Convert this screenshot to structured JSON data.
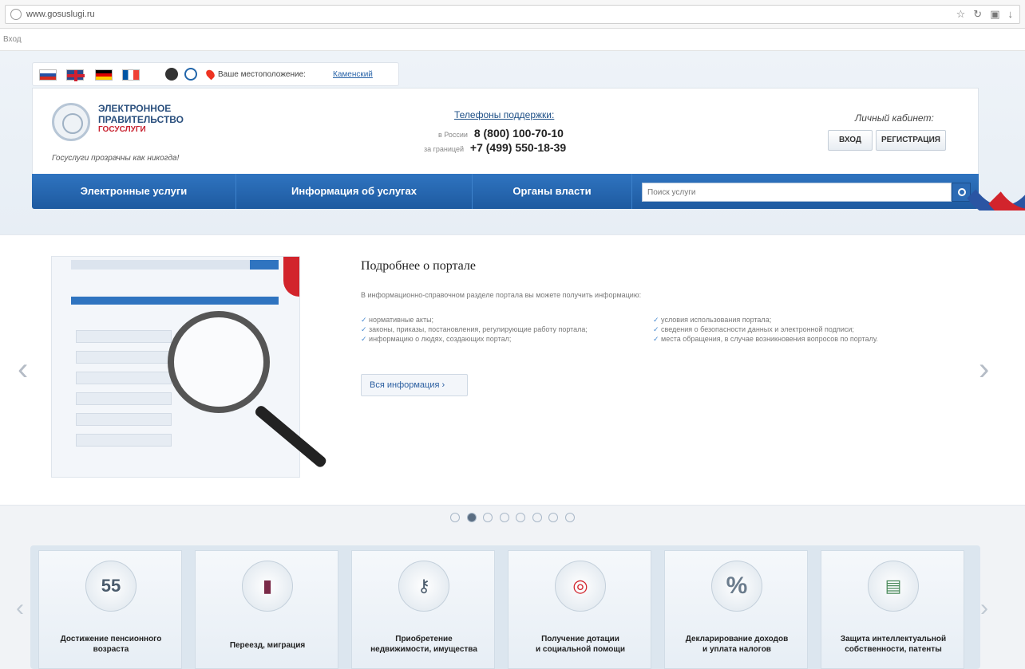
{
  "browser": {
    "url": "www.gosuslugi.ru",
    "find_text": "Вход"
  },
  "header": {
    "location_label": "Ваше местоположение:",
    "location_value": "Каменский",
    "logo": {
      "line1": "ЭЛЕКТРОННОЕ",
      "line2": "ПРАВИТЕЛЬСТВО",
      "line3": "ГОСУСЛУГИ"
    },
    "tagline": "Госуслуги прозрачны как никогда!",
    "support": {
      "title": "Телефоны поддержки:",
      "russia_label": "в России",
      "russia_phone": "8 (800) 100-70-10",
      "abroad_label": "за границей",
      "abroad_phone": "+7 (499) 550-18-39"
    },
    "cabinet": {
      "title": "Личный кабинет:",
      "login": "ВХОД",
      "register": "РЕГИСТРАЦИЯ"
    }
  },
  "nav": {
    "items": [
      "Электронные услуги",
      "Информация об услугах",
      "Органы власти"
    ],
    "search_placeholder": "Поиск услуги"
  },
  "slide": {
    "title": "Подробнее о портале",
    "intro": "В информационно-справочном разделе портала вы можете получить информацию:",
    "col1": [
      "нормативные акты;",
      "законы, приказы, постановления, регулирующие работу портала;",
      "информацию о людях, создающих портал;"
    ],
    "col2": [
      "условия использования портала;",
      "сведения о безопасности данных и электронной подписи;",
      "места обращения, в случае возникновения вопросов по порталу."
    ],
    "more_button": "Вся информация"
  },
  "tiles": [
    {
      "icon": "pension-icon",
      "glyph": "55",
      "line1": "Достижение пенсионного",
      "line2": "возраста"
    },
    {
      "icon": "passport-icon",
      "glyph": "▮",
      "line1": "Переезд, миграция",
      "line2": ""
    },
    {
      "icon": "keys-icon",
      "glyph": "⚷",
      "line1": "Приобретение",
      "line2": "недвижимости, имущества"
    },
    {
      "icon": "lifebuoy-icon",
      "glyph": "◎",
      "line1": "Получение дотации",
      "line2": "и социальной помощи"
    },
    {
      "icon": "percent-icon",
      "glyph": "%",
      "line1": "Декларирование доходов",
      "line2": "и уплата налогов"
    },
    {
      "icon": "certificate-icon",
      "glyph": "▤",
      "line1": "Защита интеллектуальной",
      "line2": "собственности, патенты"
    }
  ],
  "colors": {
    "nav_blue": "#2f74c0",
    "brand_red": "#d2242c",
    "brand_dark_blue": "#2a55a3"
  }
}
